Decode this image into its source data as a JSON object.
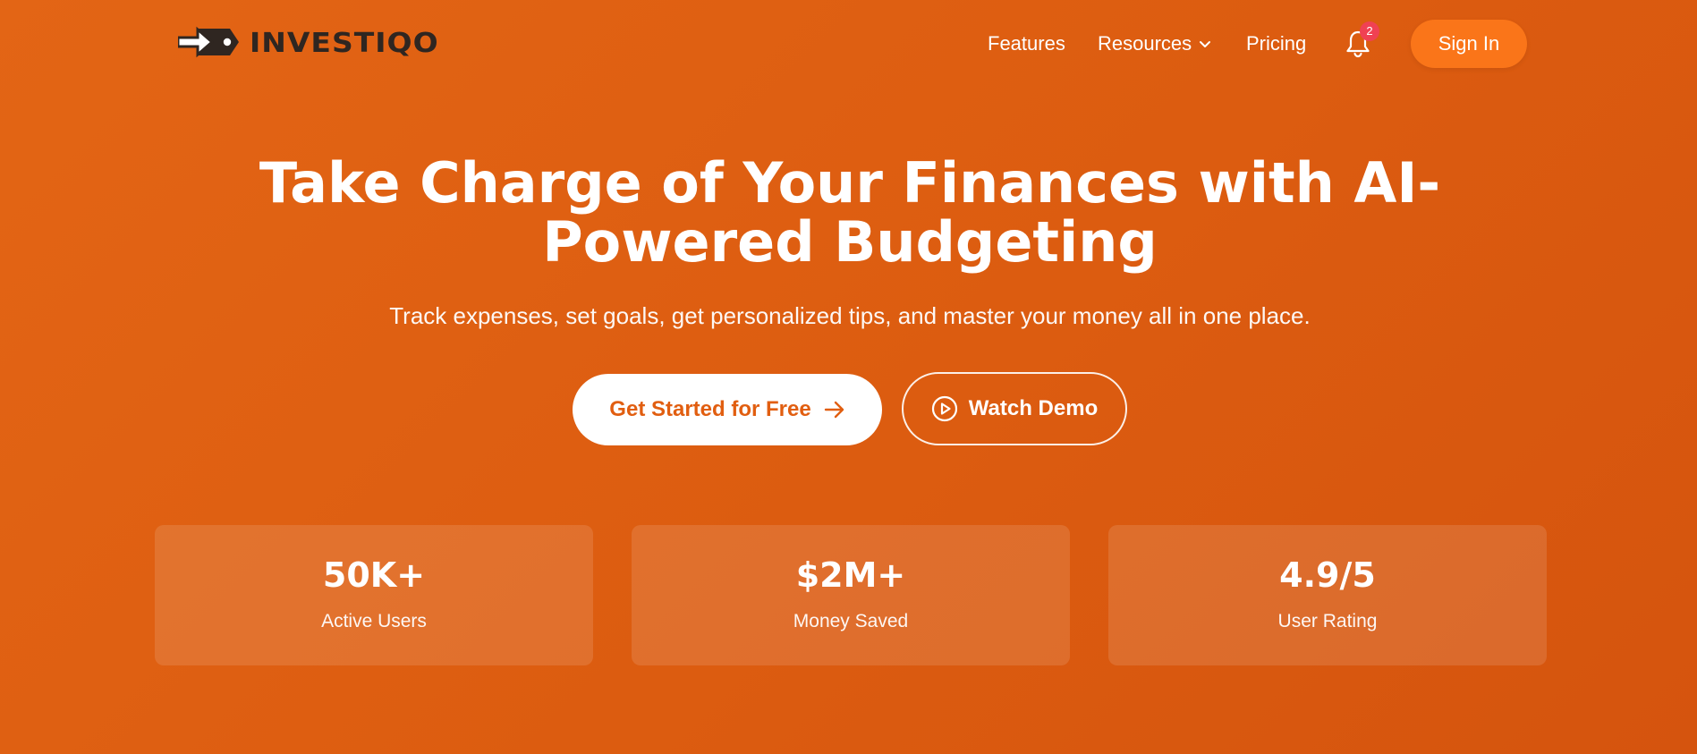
{
  "brand": {
    "name": "INVESTIQO",
    "logo_icon": "arrow-tag-logo-icon",
    "text_color": "#2F2621"
  },
  "nav": {
    "links": [
      {
        "label": "Features"
      },
      {
        "label": "Resources",
        "icon": "chevron-down-icon"
      },
      {
        "label": "Pricing"
      }
    ],
    "notifications": {
      "icon": "bell-icon",
      "count": "2",
      "badge_color": "#F04153"
    },
    "signin_label": "Sign In",
    "signin_color": "#FA7519"
  },
  "hero": {
    "title": "Take Charge of Your Finances with AI-Powered Budgeting",
    "subtitle": "Track expenses, set goals, get personalized tips, and master your money all in one place.",
    "primary_cta": {
      "label": "Get Started for Free",
      "icon": "arrow-right-icon"
    },
    "secondary_cta": {
      "label": "Watch Demo",
      "icon": "play-circle-icon"
    }
  },
  "stats": [
    {
      "value": "50K+",
      "label": "Active Users"
    },
    {
      "value": "$2M+",
      "label": "Money Saved"
    },
    {
      "value": "4.9/5",
      "label": "User Rating"
    }
  ],
  "colors": {
    "background_start": "#E36515",
    "background_end": "#D5540E",
    "primary_text_on_white": "#E15E10"
  }
}
